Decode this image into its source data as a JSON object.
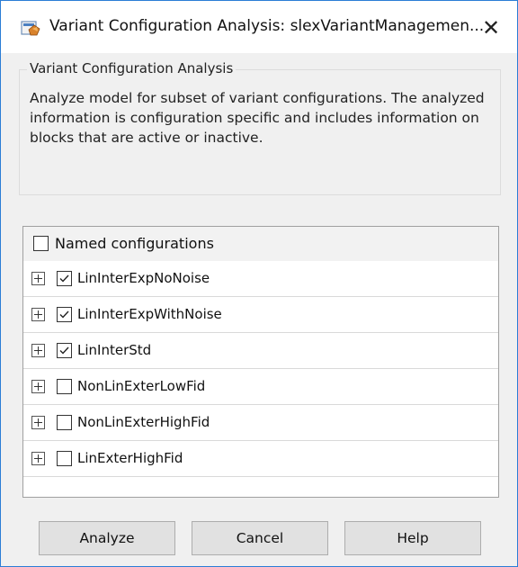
{
  "window": {
    "title": "Variant Configuration Analysis: slexVariantManagemen...",
    "app_icon": "matlab-simulink-icon",
    "close_glyph": "✕",
    "border_color": "#2b7dd6"
  },
  "description": {
    "legend": "Variant Configuration Analysis",
    "text": "Analyze model for subset of variant configurations. The analyzed information is configuration specific and includes information on blocks that are active or inactive."
  },
  "table": {
    "header": {
      "label": "Named configurations",
      "checked": false
    },
    "rows": [
      {
        "label": "LinInterExpNoNoise",
        "checked": true
      },
      {
        "label": "LinInterExpWithNoise",
        "checked": true
      },
      {
        "label": "LinInterStd",
        "checked": true
      },
      {
        "label": "NonLinExterLowFid",
        "checked": false
      },
      {
        "label": "NonLinExterHighFid",
        "checked": false
      },
      {
        "label": "LinExterHighFid",
        "checked": false
      }
    ]
  },
  "buttons": {
    "analyze": "Analyze",
    "cancel": "Cancel",
    "help": "Help"
  }
}
